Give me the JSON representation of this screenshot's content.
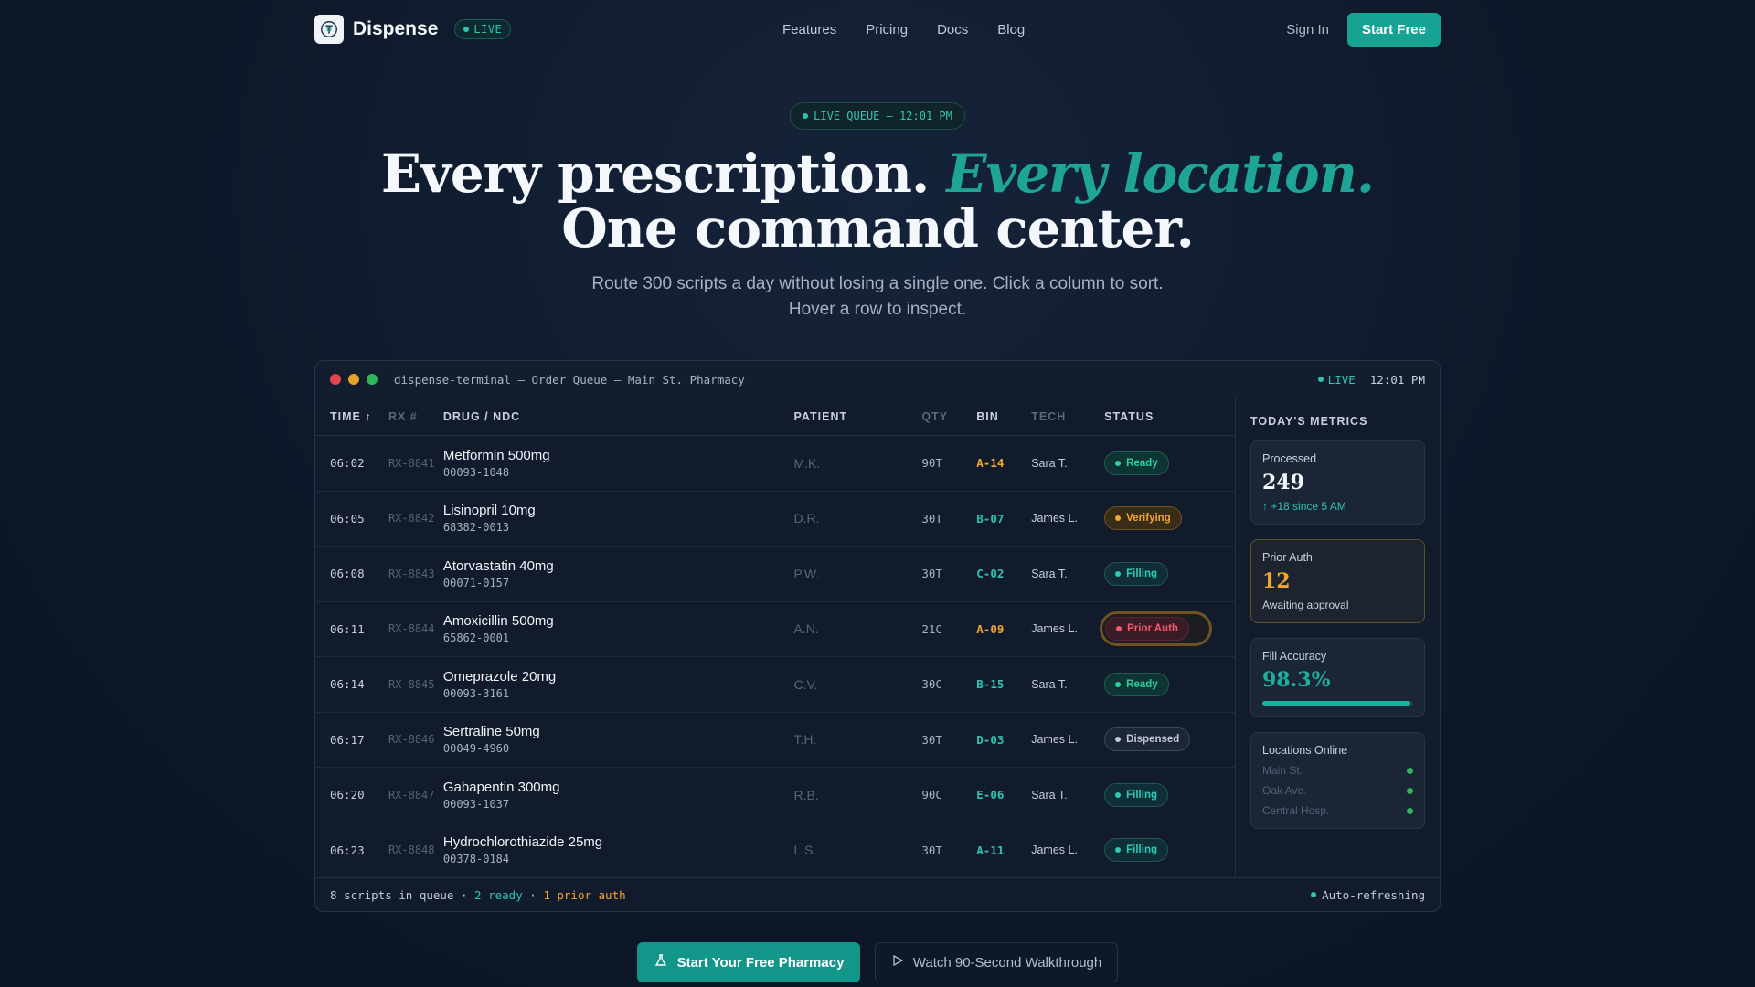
{
  "colors": {
    "accent": "#1fa596",
    "teal": "#2fc4b2",
    "amber": "#f3a633",
    "red": "#f05a6a",
    "bg": "#0e1829"
  },
  "nav": {
    "brand": "Dispense",
    "live": "LIVE",
    "links": [
      "Features",
      "Pricing",
      "Docs",
      "Blog"
    ],
    "sign_in": "Sign In",
    "start_free": "Start Free"
  },
  "hero": {
    "pill": "LIVE QUEUE — 12:01 PM",
    "title_a": "Every prescription. ",
    "title_b": "Every location.",
    "title_c": "One command center.",
    "subtitle": "Route 300 scripts a day without losing a single one. Click a column to sort. Hover a row to inspect."
  },
  "terminal": {
    "title": "dispense-terminal — Order Queue — Main St. Pharmacy",
    "live": "LIVE",
    "time": "12:01 PM",
    "columns": {
      "time": "TIME ↑",
      "rx": "RX #",
      "drug": "DRUG / NDC",
      "patient": "PATIENT",
      "qty": "QTY",
      "bin": "BIN",
      "tech": "TECH",
      "status": "STATUS"
    },
    "rows": [
      {
        "time": "06:02",
        "rx": "RX-8841",
        "drug": "Metformin 500mg",
        "ndc": "00093-1048",
        "patient": "M.K.",
        "qty": "90T",
        "bin": "A-14",
        "tech": "Sara T.",
        "status": "Ready"
      },
      {
        "time": "06:05",
        "rx": "RX-8842",
        "drug": "Lisinopril 10mg",
        "ndc": "68382-0013",
        "patient": "D.R.",
        "qty": "30T",
        "bin": "B-07",
        "tech": "James L.",
        "status": "Verifying"
      },
      {
        "time": "06:08",
        "rx": "RX-8843",
        "drug": "Atorvastatin 40mg",
        "ndc": "00071-0157",
        "patient": "P.W.",
        "qty": "30T",
        "bin": "C-02",
        "tech": "Sara T.",
        "status": "Filling"
      },
      {
        "time": "06:11",
        "rx": "RX-8844",
        "drug": "Amoxicillin 500mg",
        "ndc": "65862-0001",
        "patient": "A.N.",
        "qty": "21C",
        "bin": "A-09",
        "tech": "James L.",
        "status": "Prior Auth"
      },
      {
        "time": "06:14",
        "rx": "RX-8845",
        "drug": "Omeprazole 20mg",
        "ndc": "00093-3161",
        "patient": "C.V.",
        "qty": "30C",
        "bin": "B-15",
        "tech": "Sara T.",
        "status": "Ready"
      },
      {
        "time": "06:17",
        "rx": "RX-8846",
        "drug": "Sertraline 50mg",
        "ndc": "00049-4960",
        "patient": "T.H.",
        "qty": "30T",
        "bin": "D-03",
        "tech": "James L.",
        "status": "Dispensed"
      },
      {
        "time": "06:20",
        "rx": "RX-8847",
        "drug": "Gabapentin 300mg",
        "ndc": "00093-1037",
        "patient": "R.B.",
        "qty": "90C",
        "bin": "E-06",
        "tech": "Sara T.",
        "status": "Filling"
      },
      {
        "time": "06:23",
        "rx": "RX-8848",
        "drug": "Hydrochlorothiazide 25mg",
        "ndc": "00378-0184",
        "patient": "L.S.",
        "qty": "30T",
        "bin": "A-11",
        "tech": "James L.",
        "status": "Filling"
      }
    ],
    "metrics": {
      "heading": "TODAY'S METRICS",
      "processed": {
        "label": "Processed",
        "value": "249",
        "sub": "↑ +18 since 5 AM"
      },
      "prior_auth": {
        "label": "Prior Auth",
        "value": "12",
        "sub": "Awaiting approval"
      },
      "accuracy": {
        "label": "Fill Accuracy",
        "value": "98.3%",
        "progress": 0.983
      },
      "locations": {
        "label": "Locations Online",
        "items": [
          "Main St.",
          "Oak Ave.",
          "Central Hosp."
        ]
      }
    },
    "footer": {
      "queue": "8 scripts in queue",
      "sep": " · ",
      "ready": "2 ready",
      "prior": "1 prior auth",
      "refresh": "Auto-refreshing"
    }
  },
  "cta": {
    "primary": "Start Your Free Pharmacy",
    "secondary": "Watch 90-Second Walkthrough"
  }
}
